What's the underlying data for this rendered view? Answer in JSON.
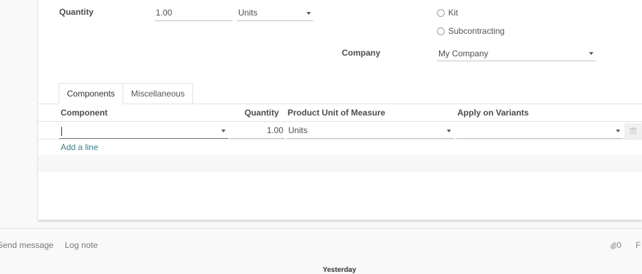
{
  "form": {
    "quantity_label": "Quantity",
    "quantity_value": "1.00",
    "uom_value": "Units",
    "bom_type_options": [
      "Kit",
      "Subcontracting"
    ],
    "company_label": "Company",
    "company_value": "My Company"
  },
  "tabs": [
    {
      "label": "Components",
      "active": true
    },
    {
      "label": "Miscellaneous",
      "active": false
    }
  ],
  "components_table": {
    "columns": [
      "Component",
      "Quantity",
      "Product Unit of Measure",
      "Apply on Variants"
    ],
    "row": {
      "component": "",
      "quantity": "1.00",
      "uom": "Units",
      "variants": ""
    },
    "add_line_label": "Add a line"
  },
  "chatter": {
    "send_message_label": "Send message",
    "log_note_label": "Log note",
    "attachment_count": "0",
    "follow_label": "F",
    "date_divider": "Yesterday"
  }
}
